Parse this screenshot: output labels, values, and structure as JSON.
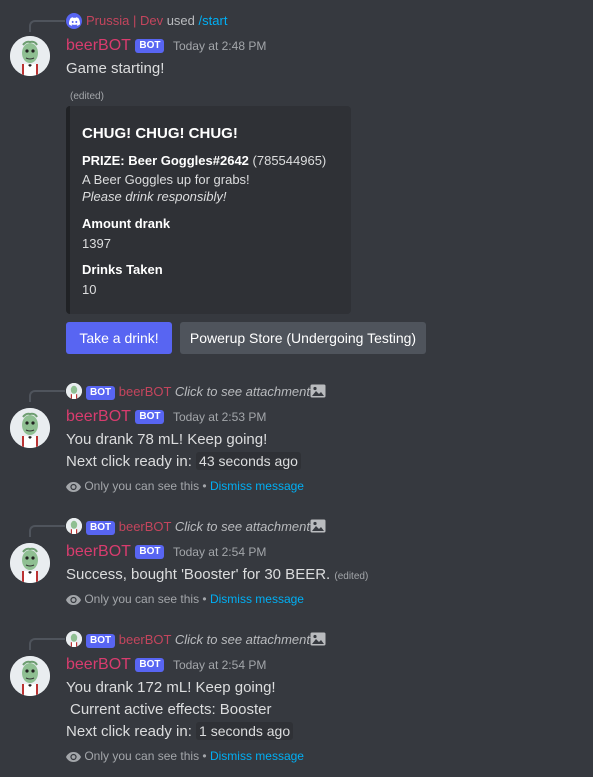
{
  "colors": {
    "background": "#36393f",
    "embed_background": "#2f3136",
    "username": "#d83c6e",
    "blurple": "#5865f2",
    "link": "#00aff4"
  },
  "message1": {
    "reply": {
      "user": "Prussia | Dev",
      "verb": "used",
      "command": "/start",
      "icon": "discord-icon"
    },
    "author": "beerBOT",
    "tag": "BOT",
    "timestamp": "Today at 2:48 PM",
    "content": "Game starting!",
    "edited": "(edited)",
    "embed": {
      "title": "CHUG! CHUG! CHUG!",
      "prize_label": "PRIZE: Beer Goggles#2642",
      "prize_id": "(785544965)",
      "line1": "A Beer Goggles up for grabs!",
      "line2": "Please drink responsibly!",
      "field1_name": "Amount drank",
      "field1_value": "1397",
      "field2_name": "Drinks Taken",
      "field2_value": "10"
    },
    "buttons": {
      "drink": "Take a drink!",
      "store": "Powerup Store (Undergoing Testing)"
    }
  },
  "message2": {
    "reply": {
      "tag": "BOT",
      "user": "beerBOT",
      "text": "Click to see attachment",
      "icon": "image-icon"
    },
    "author": "beerBOT",
    "tag": "BOT",
    "timestamp": "Today at 2:53 PM",
    "line1": "You drank 78 mL! Keep going!",
    "line2_prefix": "Next click ready in:",
    "line2_code": "43 seconds ago",
    "ephemeral": "Only you can see this •",
    "dismiss": "Dismiss message"
  },
  "message3": {
    "reply": {
      "tag": "BOT",
      "user": "beerBOT",
      "text": "Click to see attachment",
      "icon": "image-icon"
    },
    "author": "beerBOT",
    "tag": "BOT",
    "timestamp": "Today at 2:54 PM",
    "line1": "Success, bought 'Booster' for 30 BEER.",
    "edited": "(edited)",
    "ephemeral": "Only you can see this •",
    "dismiss": "Dismiss message"
  },
  "message4": {
    "reply": {
      "tag": "BOT",
      "user": "beerBOT",
      "text": "Click to see attachment",
      "icon": "image-icon"
    },
    "author": "beerBOT",
    "tag": "BOT",
    "timestamp": "Today at 2:54 PM",
    "line1": "You drank 172 mL! Keep going!",
    "line2": "Current active effects: Booster",
    "line3_prefix": "Next click ready in:",
    "line3_code": "1 seconds ago",
    "ephemeral": "Only you can see this •",
    "dismiss": "Dismiss message"
  }
}
